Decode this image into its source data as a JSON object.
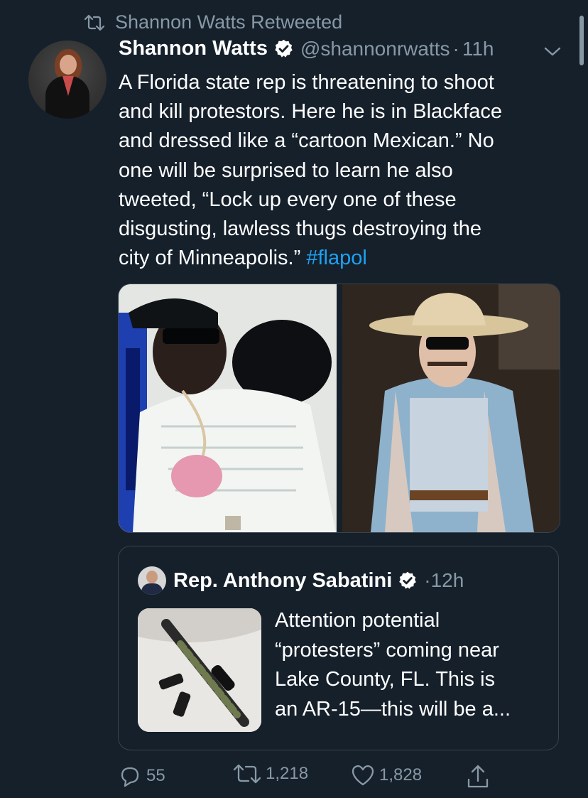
{
  "retweet": {
    "label": "Shannon Watts Retweeted"
  },
  "tweet": {
    "author_name": "Shannon Watts",
    "handle": "@shannonrwatts",
    "separator": "·",
    "time": "11h",
    "text_lines": [
      "A Florida state rep is threatening to shoot",
      "and kill protestors. Here he is in Blackface",
      "and dressed like a “cartoon Mexican.” No",
      "one will be surprised to learn he also",
      "tweeted, “Lock up every one of these",
      "disgusting, lawless thugs destroying the",
      "city of Minneapolis.” "
    ],
    "hashtag": "#flapol"
  },
  "quote": {
    "author_name": "Rep. Anthony Sabatini",
    "separator": "·",
    "time": "12h",
    "text_lines": [
      "Attention potential",
      "“protesters” coming near",
      "Lake County, FL.  This is",
      "an AR-15—this will be a..."
    ]
  },
  "actions": {
    "replies": "55",
    "retweets": "1,218",
    "likes": "1,828"
  },
  "colors": {
    "background": "#15202b",
    "secondary_text": "#8899a6",
    "link": "#1da1f2",
    "border": "#38444d"
  },
  "icons": [
    "retweet-icon",
    "verified-badge-icon",
    "chevron-down-icon",
    "reply-icon",
    "like-icon",
    "share-icon"
  ]
}
